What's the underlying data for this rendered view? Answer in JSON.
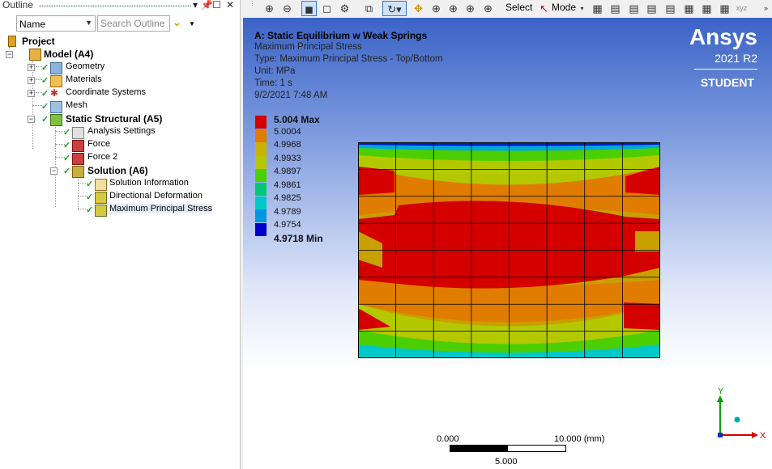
{
  "outline": {
    "title": "Outline",
    "pin_icon": "pin-icon",
    "restore_icon": "restore-icon",
    "close_icon": "close-icon",
    "name_select": "Name",
    "search_placeholder": "Search Outline",
    "filter_icon": "filter-icon"
  },
  "tree": {
    "project": "Project",
    "model": "Model (A4)",
    "geometry": "Geometry",
    "materials": "Materials",
    "coordinate_systems": "Coordinate Systems",
    "mesh": "Mesh",
    "static_structural": "Static Structural (A5)",
    "analysis_settings": "Analysis Settings",
    "force": "Force",
    "force2": "Force 2",
    "solution": "Solution (A6)",
    "solution_information": "Solution Information",
    "directional_deformation": "Directional Deformation",
    "max_principal_stress": "Maximum Principal Stress"
  },
  "toolbar": {
    "select_label": "Select",
    "mode_label": "Mode"
  },
  "result": {
    "title": "A: Static Equilibrium w Weak Springs",
    "name": "Maximum Principal Stress",
    "type": "Type: Maximum Principal Stress - Top/Bottom",
    "unit": "Unit: MPa",
    "time": "Time: 1 s",
    "date": "9/2/2021 7:48 AM"
  },
  "brand": {
    "logo": "Ansys",
    "version": "2021 R2",
    "edition": "STUDENT"
  },
  "legend": {
    "max_label": "5.004 Max",
    "min_label": "4.9718 Min",
    "values": [
      "5.0004",
      "4.9968",
      "4.9933",
      "4.9897",
      "4.9861",
      "4.9825",
      "4.9789",
      "4.9754"
    ],
    "colors": [
      "#d40000",
      "#e07c00",
      "#c8b400",
      "#b4c800",
      "#4ccf00",
      "#00c878",
      "#00c8c8",
      "#0096e0",
      "#0000c8"
    ]
  },
  "scale": {
    "left": "0.000",
    "right": "10.000 (mm)",
    "mid": "5.000"
  },
  "triad": {
    "x": "X",
    "y": "Y"
  }
}
